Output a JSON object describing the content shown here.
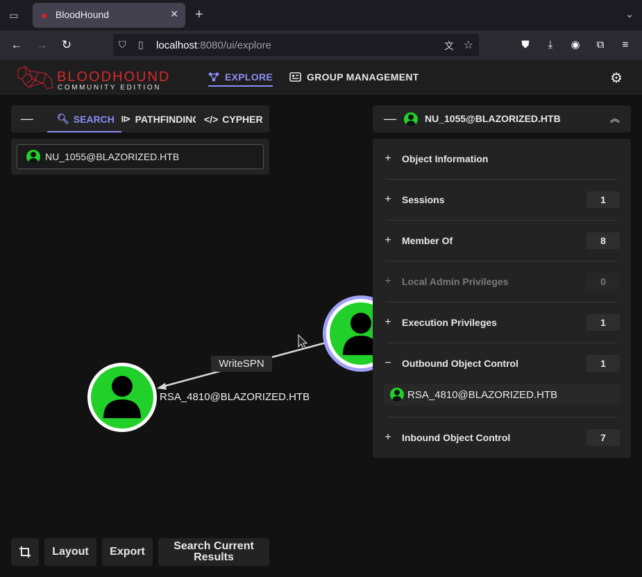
{
  "browser": {
    "tab_title": "BloodHound",
    "url_host": "localhost",
    "url_rest": ":8080/ui/explore"
  },
  "app": {
    "logo_title": "BLOODHOUND",
    "logo_subtitle": "COMMUNITY EDITION",
    "nav": {
      "explore": "EXPLORE",
      "group_management": "GROUP MANAGEMENT"
    }
  },
  "search_panel": {
    "tabs": {
      "search": "SEARCH",
      "pathfinding": "PATHFINDING",
      "cypher": "CYPHER"
    },
    "search_value": "NU_1055@BLAZORIZED.HTB"
  },
  "graph": {
    "edge_label": "WriteSPN",
    "target_node_label": "RSA_4810@BLAZORIZED.HTB"
  },
  "entity_panel": {
    "title": "NU_1055@BLAZORIZED.HTB",
    "sections": {
      "object_information": {
        "label": "Object Information"
      },
      "sessions": {
        "label": "Sessions",
        "count": "1"
      },
      "member_of": {
        "label": "Member Of",
        "count": "8"
      },
      "local_admin": {
        "label": "Local Admin Privileges",
        "count": "0"
      },
      "execution": {
        "label": "Execution Privileges",
        "count": "1"
      },
      "outbound": {
        "label": "Outbound Object Control",
        "count": "1",
        "items": [
          "RSA_4810@BLAZORIZED.HTB"
        ]
      },
      "inbound": {
        "label": "Inbound Object Control",
        "count": "7"
      }
    }
  },
  "controls": {
    "layout": "Layout",
    "export": "Export",
    "search_current_results": "Search Current Results"
  },
  "colors": {
    "accent": "#8b8ef5",
    "user_node": "#21d12a",
    "brand_red": "#d42a2a"
  }
}
